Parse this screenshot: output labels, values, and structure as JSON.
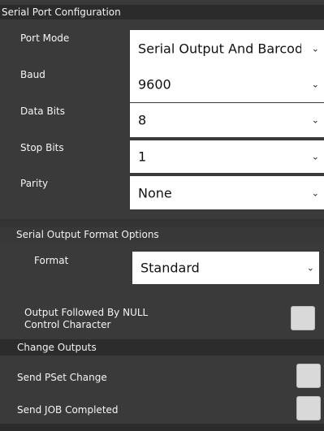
{
  "serial_port": {
    "heading": "Serial Port Configuration",
    "fields": [
      {
        "label": "Port Mode",
        "value": "Serial Output And Barcode"
      },
      {
        "label": "Baud",
        "value": "9600"
      },
      {
        "label": "Data Bits",
        "value": "8"
      },
      {
        "label": "Stop Bits",
        "value": "1"
      },
      {
        "label": "Parity",
        "value": "None"
      }
    ]
  },
  "output_format": {
    "heading": "Serial Output Format Options",
    "format_label": "Format",
    "format_value": "Standard",
    "null_label_line1": "Output Followed By NULL",
    "null_label_line2": "Control Character",
    "null_checked": false
  },
  "change_outputs": {
    "heading": "Change Outputs",
    "pset_label": "Send PSet Change",
    "pset_checked": false,
    "job_label": "Send JOB Completed",
    "job_checked": false
  },
  "icons": {
    "dropdown": "chevron-down-icon"
  },
  "colors": {
    "panel_bg": "#3a3a3a",
    "header_bg": "#2b2b2b",
    "input_bg": "#ffffff",
    "checkbox_bg": "#d9d9d9"
  }
}
